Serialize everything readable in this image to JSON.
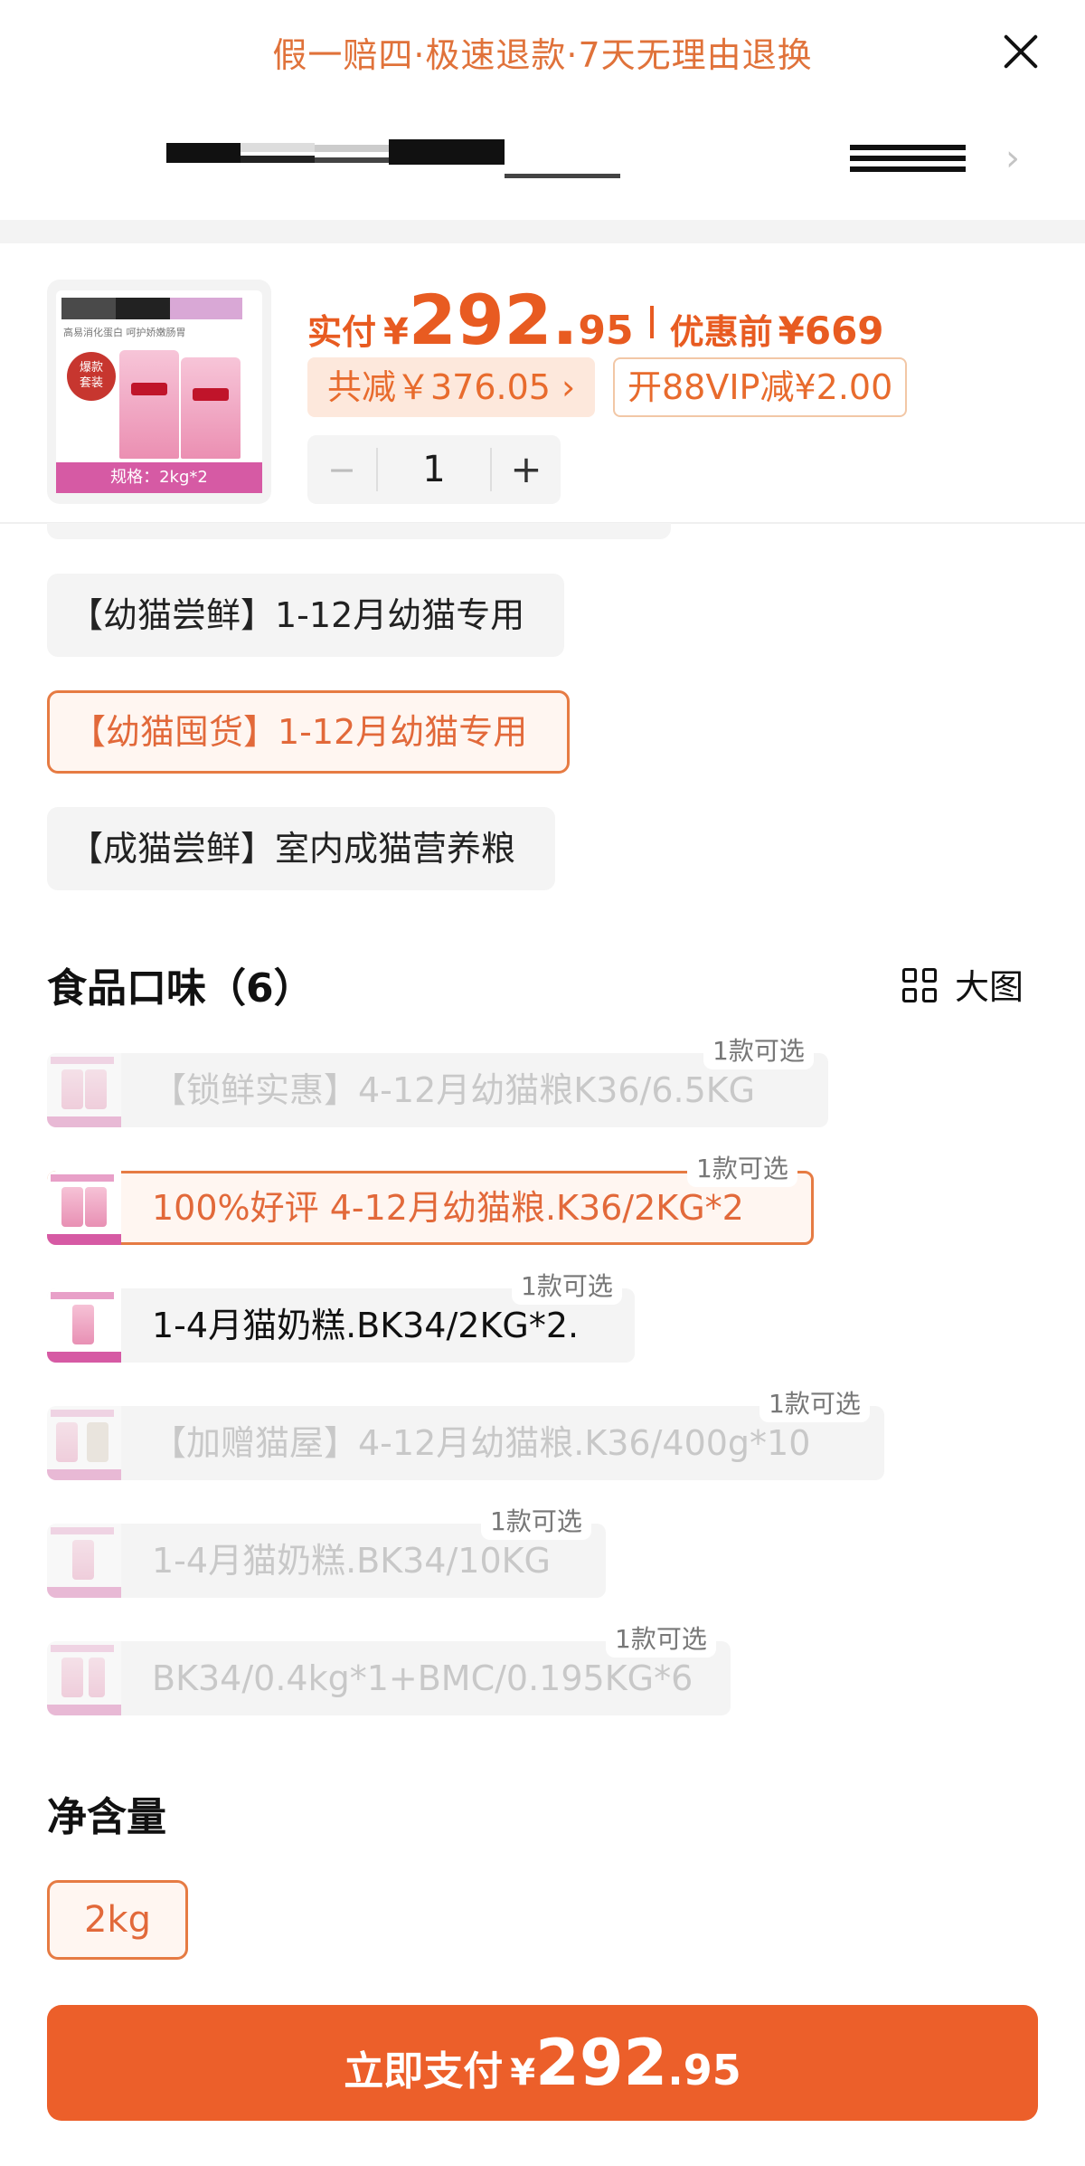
{
  "header": {
    "guarantee_text": "假一赔四·极速退款·7天无理由退换",
    "close_icon": "close-icon",
    "tab_strip_arrow_icon": "chevron-right-icon"
  },
  "product": {
    "thumbnail_spec": "规格：2kg*2",
    "thumbnail_badge": "爆款\n套装",
    "thumbnail_caption": "高易消化蛋白 呵护娇嫩肠胃",
    "price_label": "实付",
    "currency": "¥",
    "price_integer": "292.",
    "price_decimal": "95",
    "original_label": "优惠前",
    "original_price": "¥669",
    "discount_chip": "共减￥376.05 ›",
    "vip_chip": "开88VIP减¥2.00",
    "quantity": "1",
    "minus_label": "−",
    "plus_label": "+"
  },
  "variants": [
    {
      "label": "【幼猫尝鲜】1-12月幼猫专用",
      "selected": false
    },
    {
      "label": "【幼猫囤货】1-12月幼猫专用",
      "selected": true
    },
    {
      "label": "【成猫尝鲜】室内成猫营养粮",
      "selected": false
    }
  ],
  "flavor_section": {
    "title": "食品口味（6）",
    "big_view_label": "大图",
    "big_view_icon": "grid-icon"
  },
  "flavors": [
    {
      "label": "【锁鲜实惠】4-12月幼猫粮K36/6.5KG",
      "badge": "1款可选",
      "state": "disabled"
    },
    {
      "label": "100%好评  4-12月幼猫粮.K36/2KG*2",
      "badge": "1款可选",
      "state": "selected"
    },
    {
      "label": "1-4月猫奶糕.BK34/2KG*2.",
      "badge": "1款可选",
      "state": "normal"
    },
    {
      "label": "【加赠猫屋】4-12月幼猫粮.K36/400g*10",
      "badge": "1款可选",
      "state": "disabled"
    },
    {
      "label": "1-4月猫奶糕.BK34/10KG",
      "badge": "1款可选",
      "state": "disabled"
    },
    {
      "label": "BK34/0.4kg*1+BMC/0.195KG*6",
      "badge": "1款可选",
      "state": "disabled"
    }
  ],
  "net_content": {
    "title": "净含量",
    "option": "2kg"
  },
  "pay_button": {
    "label": "立即支付",
    "currency": "¥",
    "integer": "292",
    "decimal": ".95"
  },
  "colors": {
    "accent": "#ec5f2a",
    "accent_text": "#e2693a",
    "selected_border": "#e67b43",
    "chip_bg": "#f4f4f4",
    "disabled_text": "#c8c8c8"
  }
}
